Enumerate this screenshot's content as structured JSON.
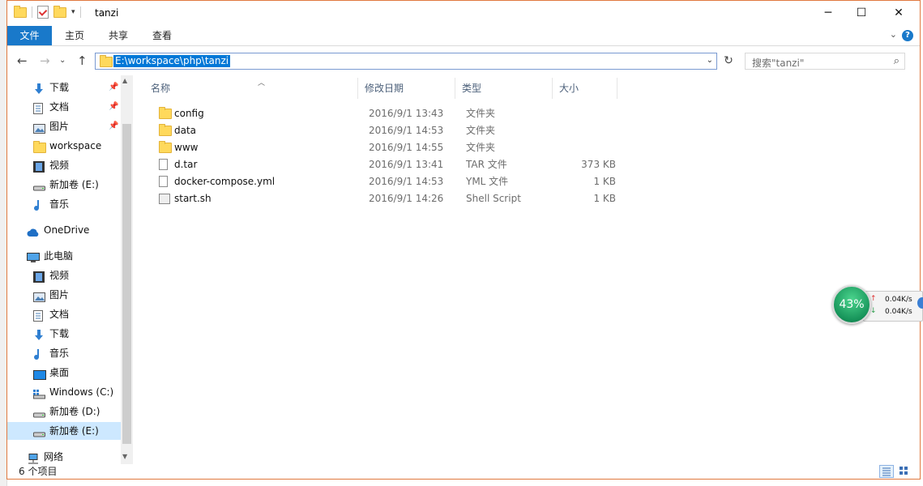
{
  "window": {
    "title": "tanzi",
    "controls": {
      "minimize": "─",
      "maximize": "☐",
      "close": "✕"
    }
  },
  "ribbon": {
    "tabs": [
      {
        "label": "文件",
        "active": true
      },
      {
        "label": "主页",
        "active": false
      },
      {
        "label": "共享",
        "active": false
      },
      {
        "label": "查看",
        "active": false
      }
    ],
    "help": "?",
    "accent_color": "#1979ca"
  },
  "nav": {
    "back": "←",
    "forward": "→",
    "recent": "⌄",
    "up": "↑",
    "address": "E:\\workspace\\php\\tanzi",
    "refresh": "↻",
    "search_placeholder": "搜索\"tanzi\"",
    "search_icon": "magnifier-icon"
  },
  "navpane": {
    "items": [
      {
        "label": "下载",
        "icon": "download-icon",
        "pinned": true
      },
      {
        "label": "文档",
        "icon": "document-icon",
        "pinned": true
      },
      {
        "label": "图片",
        "icon": "picture-icon",
        "pinned": true
      },
      {
        "label": "workspace",
        "icon": "folder-icon",
        "pinned": false
      },
      {
        "label": "视频",
        "icon": "video-icon",
        "pinned": false
      },
      {
        "label": "新加卷 (E:)",
        "icon": "drive-icon",
        "pinned": false
      },
      {
        "label": "音乐",
        "icon": "music-icon",
        "pinned": false
      },
      {
        "label": "OneDrive",
        "icon": "cloud-icon",
        "pinned": false
      },
      {
        "label": "此电脑",
        "icon": "computer-icon",
        "pinned": false
      },
      {
        "label": "视频",
        "icon": "video-icon",
        "pinned": false
      },
      {
        "label": "图片",
        "icon": "picture-icon",
        "pinned": false
      },
      {
        "label": "文档",
        "icon": "document-icon",
        "pinned": false
      },
      {
        "label": "下载",
        "icon": "download-icon",
        "pinned": false
      },
      {
        "label": "音乐",
        "icon": "music-icon",
        "pinned": false
      },
      {
        "label": "桌面",
        "icon": "desktop-icon",
        "pinned": false
      },
      {
        "label": "Windows (C:)",
        "icon": "windows-drive-icon",
        "pinned": false
      },
      {
        "label": "新加卷 (D:)",
        "icon": "drive-icon",
        "pinned": false
      },
      {
        "label": "新加卷 (E:)",
        "icon": "drive-icon",
        "pinned": false,
        "selected": true
      },
      {
        "label": "网络",
        "icon": "network-icon",
        "pinned": false
      }
    ]
  },
  "columns": {
    "name": "名称",
    "modified": "修改日期",
    "type": "类型",
    "size": "大小"
  },
  "files": [
    {
      "name": "config",
      "modified": "2016/9/1 13:43",
      "type": "文件夹",
      "size": "",
      "icon": "folder-icon"
    },
    {
      "name": "data",
      "modified": "2016/9/1 14:53",
      "type": "文件夹",
      "size": "",
      "icon": "folder-icon"
    },
    {
      "name": "www",
      "modified": "2016/9/1 14:55",
      "type": "文件夹",
      "size": "",
      "icon": "folder-icon"
    },
    {
      "name": "d.tar",
      "modified": "2016/9/1 13:41",
      "type": "TAR 文件",
      "size": "373 KB",
      "icon": "file-icon"
    },
    {
      "name": "docker-compose.yml",
      "modified": "2016/9/1 14:53",
      "type": "YML 文件",
      "size": "1 KB",
      "icon": "file-icon"
    },
    {
      "name": "start.sh",
      "modified": "2016/9/1 14:26",
      "type": "Shell Script",
      "size": "1 KB",
      "icon": "script-icon"
    }
  ],
  "status": {
    "count": "6 个项目"
  },
  "netmon": {
    "percent": "43%",
    "up": "0.04K/s",
    "down": "0.04K/s"
  }
}
